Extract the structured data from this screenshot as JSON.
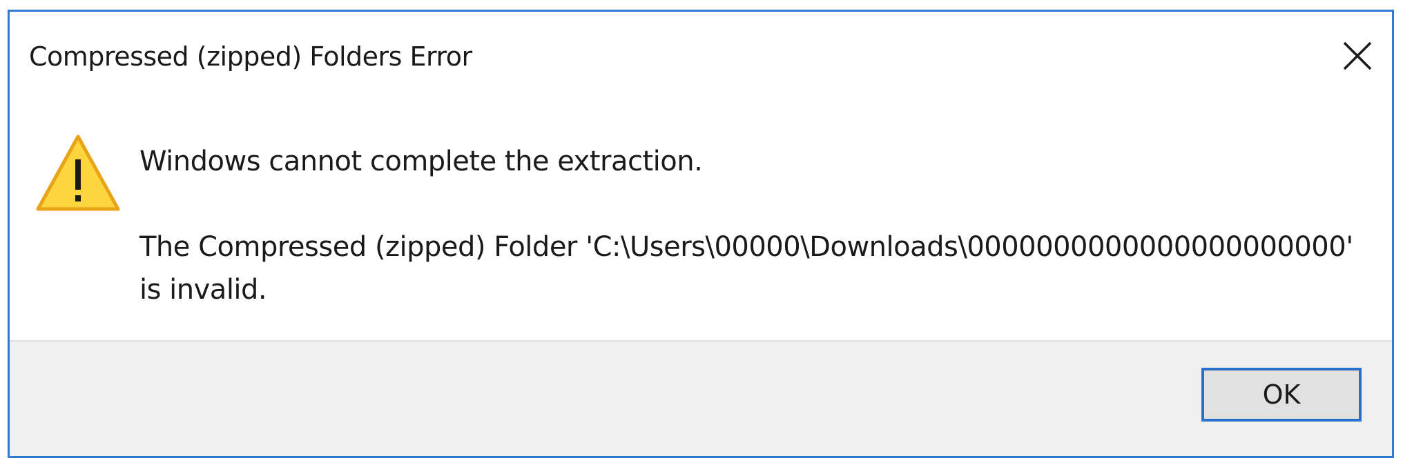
{
  "dialog": {
    "title": "Compressed (zipped) Folders Error",
    "message_main": "Windows cannot complete the extraction.",
    "message_detail": "The Compressed (zipped) Folder 'C:\\Users\\00000\\Downloads\\0000000000000000000000' is invalid.",
    "ok_label": "OK",
    "icon": "warning-icon",
    "close_icon": "close-icon"
  },
  "colors": {
    "border_accent": "#2f7ad4",
    "footer_bg": "#f0f0f0",
    "button_bg": "#e1e1e1",
    "button_border": "#2a6fcb",
    "warning_fill": "#fcd53f",
    "warning_stroke": "#e8a317"
  }
}
